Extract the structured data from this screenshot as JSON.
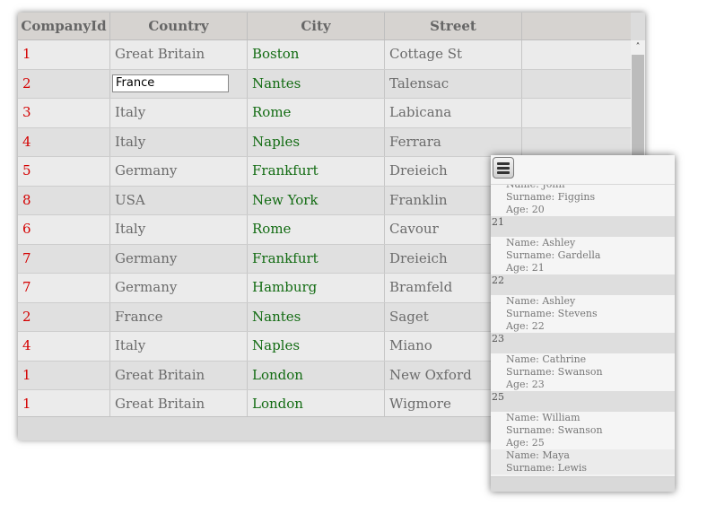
{
  "grid": {
    "columns": [
      "CompanyId",
      "Country",
      "City",
      "Street",
      ""
    ],
    "rows": [
      {
        "id": "1",
        "country": "Great Britain",
        "city": "Boston",
        "street": "Cottage St"
      },
      {
        "id": "2",
        "country": "France",
        "city": "Nantes",
        "street": "Talensac",
        "editing": true
      },
      {
        "id": "3",
        "country": "Italy",
        "city": "Rome",
        "street": "Labicana"
      },
      {
        "id": "4",
        "country": "Italy",
        "city": "Naples",
        "street": "Ferrara"
      },
      {
        "id": "5",
        "country": "Germany",
        "city": "Frankfurt",
        "street": "Dreieich"
      },
      {
        "id": "8",
        "country": "USA",
        "city": "New York",
        "street": "Franklin"
      },
      {
        "id": "6",
        "country": "Italy",
        "city": "Rome",
        "street": "Cavour"
      },
      {
        "id": "7",
        "country": "Germany",
        "city": "Frankfurt",
        "street": "Dreieich"
      },
      {
        "id": "7",
        "country": "Germany",
        "city": "Hamburg",
        "street": "Bramfeld"
      },
      {
        "id": "2",
        "country": "France",
        "city": "Nantes",
        "street": "Saget"
      },
      {
        "id": "4",
        "country": "Italy",
        "city": "Naples",
        "street": "Miano"
      },
      {
        "id": "1",
        "country": "Great Britain",
        "city": "London",
        "street": "New Oxford"
      },
      {
        "id": "1",
        "country": "Great Britain",
        "city": "London",
        "street": "Wigmore"
      }
    ],
    "scroll_up_icon": "chevron-up-icon"
  },
  "panel": {
    "menu_icon": "hamburger-menu-icon",
    "entries": [
      {
        "type": "item",
        "lines": [
          "Name: John",
          "Surname: Figgins",
          "Age: 20"
        ]
      },
      {
        "type": "group",
        "label": "21"
      },
      {
        "type": "item",
        "lines": [
          "Name: Ashley",
          "Surname: Gardella",
          "Age: 21"
        ]
      },
      {
        "type": "group",
        "label": "22"
      },
      {
        "type": "item",
        "lines": [
          "Name: Ashley",
          "Surname: Stevens",
          "Age: 22"
        ]
      },
      {
        "type": "group",
        "label": "23"
      },
      {
        "type": "item",
        "lines": [
          "Name: Cathrine",
          "Surname: Swanson",
          "Age: 23"
        ]
      },
      {
        "type": "group",
        "label": "25"
      },
      {
        "type": "item",
        "lines": [
          "Name: William",
          "Surname: Swanson",
          "Age: 25"
        ]
      },
      {
        "type": "item",
        "lines": [
          "Name: Maya",
          "Surname: Lewis"
        ]
      }
    ]
  },
  "colors": {
    "id_text": "#d40000",
    "city_text": "#126b12",
    "plain_text": "#6b6b6b"
  }
}
